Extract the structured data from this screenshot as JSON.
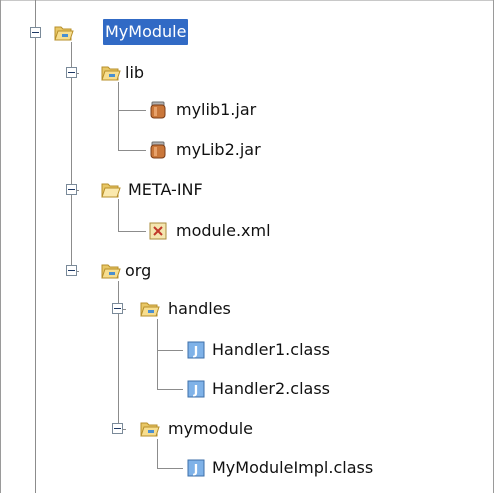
{
  "tree": {
    "selected_color": "#316ac5",
    "nodes": [
      {
        "label": "MyModule",
        "icon": "open-folder-icon",
        "selected": true
      },
      {
        "label": "lib",
        "icon": "open-folder-icon"
      },
      {
        "label": "mylib1.jar",
        "icon": "jar-file-icon"
      },
      {
        "label": "myLib2.jar",
        "icon": "jar-file-icon"
      },
      {
        "label": "META-INF",
        "icon": "open-folder-icon"
      },
      {
        "label": "module.xml",
        "icon": "xml-file-icon"
      },
      {
        "label": "org",
        "icon": "open-folder-icon"
      },
      {
        "label": "handles",
        "icon": "open-folder-icon"
      },
      {
        "label": "Handler1.class",
        "icon": "class-file-icon"
      },
      {
        "label": "Handler2.class",
        "icon": "class-file-icon"
      },
      {
        "label": "mymodule",
        "icon": "open-folder-icon"
      },
      {
        "label": "MyModuleImpl.class",
        "icon": "class-file-icon"
      }
    ]
  }
}
